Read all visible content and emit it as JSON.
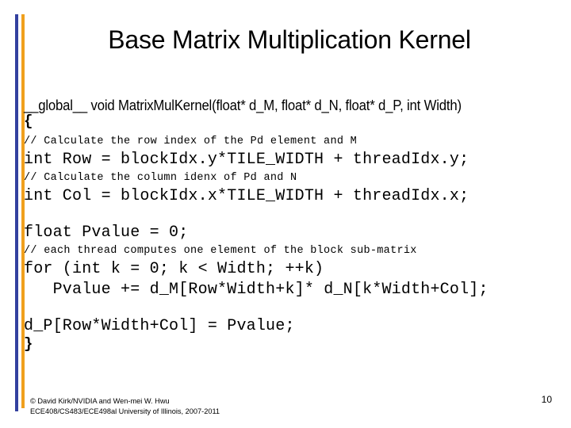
{
  "slide": {
    "title": "Base Matrix Multiplication Kernel",
    "page_number": "10",
    "accent_blue": "#33419f",
    "accent_orange": "#f0a01e"
  },
  "code": {
    "signature": "__global__ void MatrixMulKernel(float* d_M, float* d_N, float* d_P, int Width)",
    "open_brace": "{",
    "comment_row": "// Calculate the row index of the Pd element and M",
    "stmt_row": "int Row = blockIdx.y*TILE_WIDTH + threadIdx.y;",
    "comment_col": "// Calculate the column idenx of Pd and N",
    "stmt_col": "int Col = blockIdx.x*TILE_WIDTH + threadIdx.x;",
    "stmt_pvalue_init": "float Pvalue = 0;",
    "comment_each_thread": "// each thread computes one element of the block sub-matrix",
    "stmt_for": "for (int k = 0; k < Width; ++k)",
    "stmt_accum": "   Pvalue += d_M[Row*Width+k]* d_N[k*Width+Col];",
    "stmt_store": "d_P[Row*Width+Col] = Pvalue;",
    "close_brace": "}"
  },
  "footer": {
    "line1": "© David Kirk/NVIDIA and Wen-mei W. Hwu",
    "line2": "ECE408/CS483/ECE498al University of Illinois, 2007-2011"
  }
}
